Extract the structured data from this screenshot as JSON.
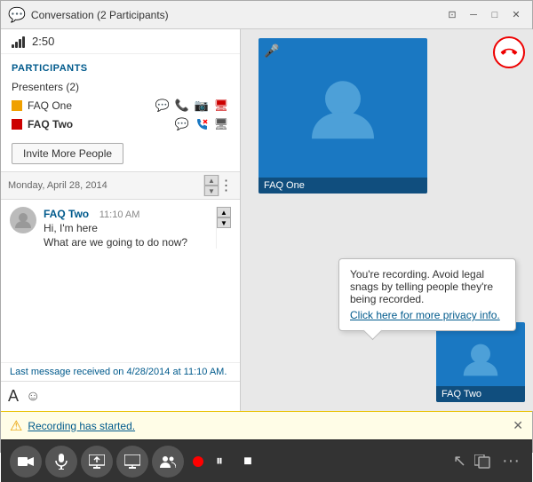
{
  "titlebar": {
    "title": "Conversation (2 Participants)",
    "icon": "💬",
    "controls": [
      "snap",
      "minimize",
      "restore",
      "close"
    ]
  },
  "time": "2:50",
  "participants": {
    "section_title": "PARTICIPANTS",
    "presenters_label": "Presenters (2)",
    "list": [
      {
        "name": "FAQ One",
        "color": "#f0a000",
        "bold": false
      },
      {
        "name": "FAQ Two",
        "color": "#cc0000",
        "bold": true
      }
    ],
    "invite_button": "Invite More People"
  },
  "chat": {
    "date_bar": "Monday, April 28, 2014",
    "messages": [
      {
        "sender": "FAQ Two",
        "time": "11:10 AM",
        "lines": [
          "Hi, I'm here",
          "What are we going to do now?"
        ]
      }
    ],
    "footer": "Last message received on 4/28/2014 at 11:10 AM."
  },
  "video": {
    "tiles": [
      {
        "name": "FAQ One",
        "size": "main"
      },
      {
        "name": "FAQ Two",
        "size": "secondary"
      }
    ]
  },
  "notification": {
    "text": "Recording has started.",
    "close": "✕"
  },
  "tooltip": {
    "line1": "You're recording. Avoid legal snags by telling people they're being recorded.",
    "link_text": "Click here for more privacy info."
  },
  "toolbar": {
    "buttons": [
      "video",
      "mic",
      "screen",
      "monitor",
      "people"
    ],
    "record_label": "●",
    "pause_label": "⏸",
    "stop_label": "■",
    "right_buttons": [
      "monitor-icon",
      "more-icon"
    ]
  },
  "end_call": "📞"
}
